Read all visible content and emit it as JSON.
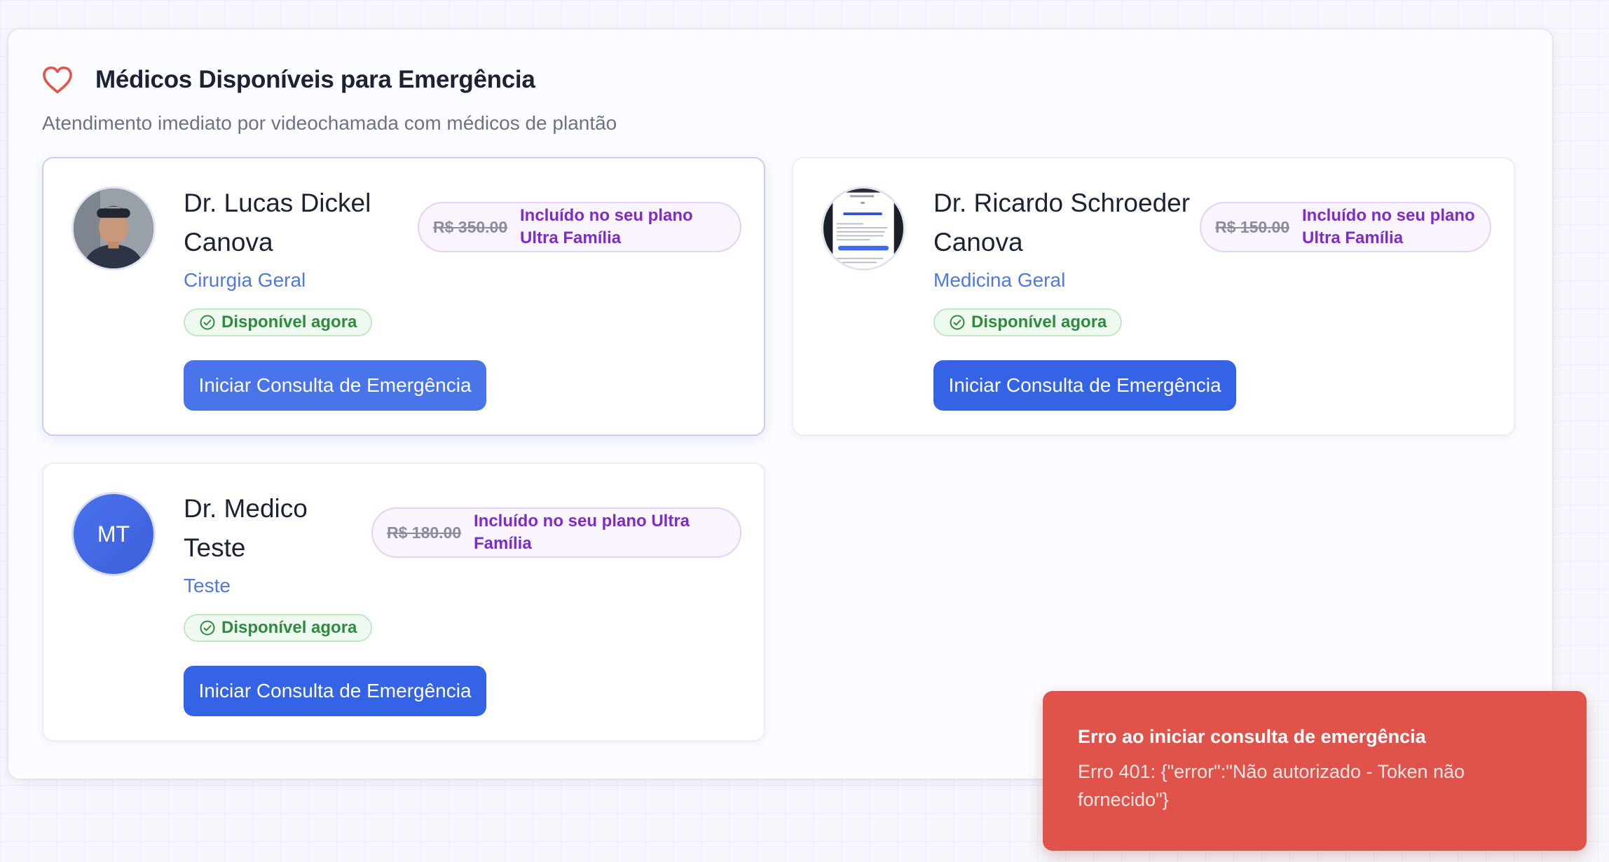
{
  "section": {
    "title": "Médicos Disponíveis para Emergência",
    "subtitle": "Atendimento imediato por videochamada com médicos de plantão",
    "icon": "heart-icon"
  },
  "doctors": [
    {
      "name": "Dr. Lucas Dickel Canova",
      "specialty": "Cirurgia Geral",
      "status": "Disponível agora",
      "price_old": "R$ 350.00",
      "plan_label": "Incluído no seu plano Ultra Família",
      "button_label": "Iniciar Consulta de Emergência",
      "avatar": "photo"
    },
    {
      "name": "Dr. Ricardo Schroeder Canova",
      "specialty": "Medicina Geral",
      "status": "Disponível agora",
      "price_old": "R$ 150.00",
      "plan_label": "Incluído no seu plano Ultra Família",
      "button_label": "Iniciar Consulta de Emergência",
      "avatar": "screenshot"
    },
    {
      "name": "Dr. Medico Teste",
      "specialty": "Teste",
      "status": "Disponível agora",
      "price_old": "R$ 180.00",
      "plan_label": "Incluído no seu plano Ultra Família",
      "button_label": "Iniciar Consulta de Emergência",
      "avatar_initials": "MT"
    }
  ],
  "toast": {
    "title": "Erro ao iniciar consulta de emergência",
    "message": "Erro 401: {\"error\":\"Não autorizado - Token não fornecido\"}"
  },
  "colors": {
    "primary_button": "#3563e6",
    "specialty_text": "#4f78e0",
    "available_green": "#2f8a3f",
    "plan_purple": "#7d2cc7",
    "toast_bg": "#e0534a",
    "heart": "#e2564c"
  }
}
